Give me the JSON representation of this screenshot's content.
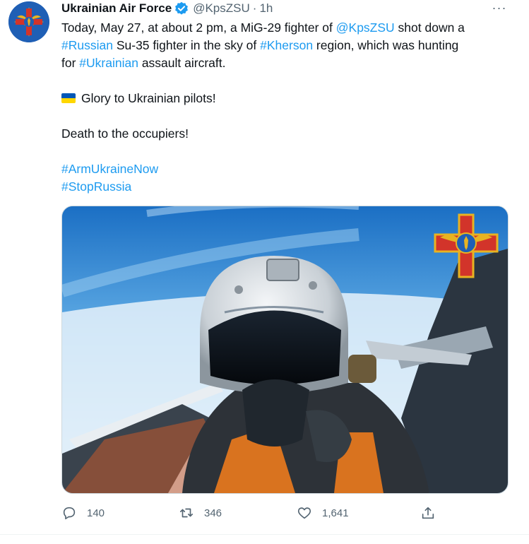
{
  "tweet": {
    "author": {
      "display_name": "Ukrainian Air Force",
      "handle": "@KpsZSU",
      "separator": "·",
      "time": "1h",
      "verified": true,
      "avatar_icon": "air-force-emblem-icon"
    },
    "more_label": "···",
    "text": {
      "l1_a": "Today, May 27, at about 2 pm, a MiG-29 fighter of ",
      "l1_link": "@KpsZSU",
      "l1_b": " shot down a",
      "l2_link1": "#Russian",
      "l2_a": " Su-35 fighter in the sky of ",
      "l2_link2": "#Kherson",
      "l2_b": " region, which was hunting",
      "l3_a": "for ",
      "l3_link": "#Ukrainian",
      "l3_b": " assault aircraft.",
      "glory": "Glory to Ukrainian pilots!",
      "death": "Death to the occupiers!",
      "hashtag1": "#ArmUkraineNow",
      "hashtag2": "#StopRussia"
    },
    "flag_icon": "ukraine-flag-icon",
    "media": {
      "kind": "photo",
      "emblem_icon": "air-force-cross-emblem-icon"
    },
    "actions": {
      "replies": "140",
      "retweets": "346",
      "likes": "1,641"
    },
    "colors": {
      "link": "#1d9bf0",
      "muted": "#536471",
      "verified": "#1d9bf0"
    }
  }
}
